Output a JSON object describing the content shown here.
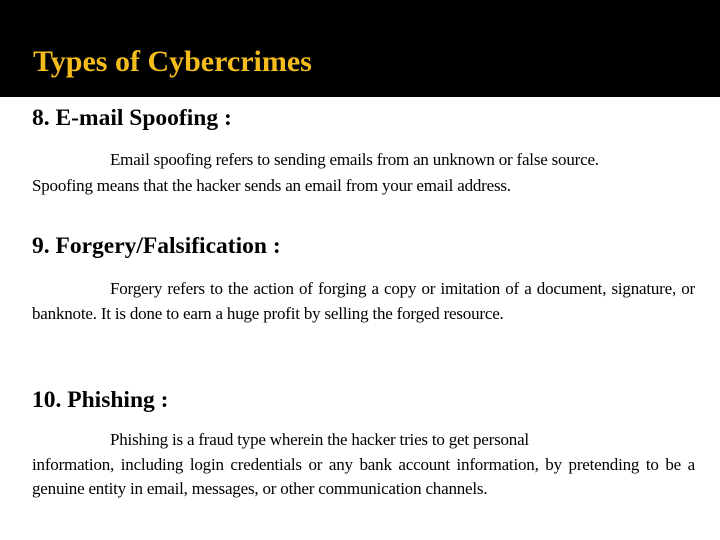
{
  "slide": {
    "title": "Types of Cybercrimes",
    "title_color": "#f4bc1c",
    "header_bg": "#000000",
    "sections": [
      {
        "heading": "8. E-mail Spoofing :",
        "paragraph_line1": "Email spoofing refers to sending emails from an unknown or false source.",
        "paragraph_rest": "Spoofing means that the hacker sends an email from your email address."
      },
      {
        "heading": "9. Forgery/Falsification :",
        "paragraph": "Forgery refers to the action of forging a copy or imitation of a document, signature, or banknote. It is done to earn a huge profit by selling the forged resource."
      },
      {
        "heading": "10. Phishing :",
        "paragraph_line1": "Phishing is a fraud type wherein the hacker tries to get personal",
        "paragraph_rest": "information, including login credentials or any bank account information, by pretending to be a genuine entity in email, messages, or other communication channels."
      }
    ]
  }
}
